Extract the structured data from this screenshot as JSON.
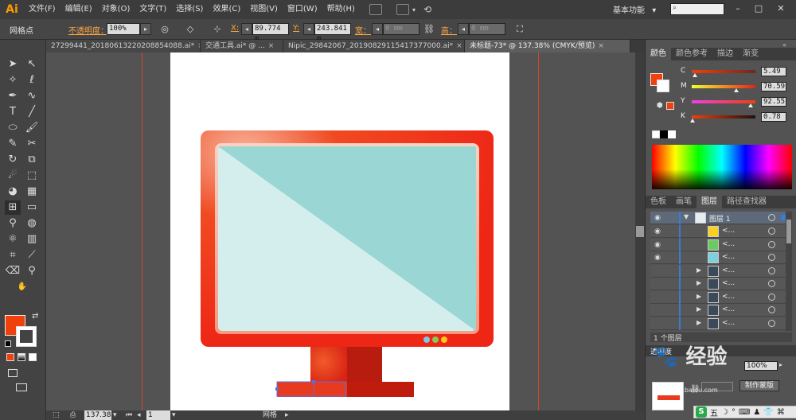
{
  "menubar": {
    "logo": "Ai",
    "items": [
      "文件(F)",
      "编辑(E)",
      "对象(O)",
      "文字(T)",
      "选择(S)",
      "效果(C)",
      "视图(V)",
      "窗口(W)",
      "帮助(H)"
    ],
    "workspace": "基本功能",
    "workspace_arrow": "▾",
    "search_placeholder": ""
  },
  "controlbar": {
    "tool_name": "网格点",
    "opacity_label": "不透明度：",
    "opacity_value": "100%",
    "x_label": "X:",
    "x_value": "89.774 m",
    "y_label": "Y:",
    "y_value": "243.841 m",
    "w_label": "宽：",
    "w_value": "0 mm",
    "h_label": "高：",
    "h_value": "0 mm"
  },
  "tabs": [
    {
      "label": "27299441_20180613220208854088.ai*",
      "active": false
    },
    {
      "label": "交通工具.ai* @ ...",
      "active": false
    },
    {
      "label": "Nipic_29842067_20190829115417377000.ai*",
      "active": false
    },
    {
      "label": "未标题-73* @ 137.38% (CMYK/预览)",
      "active": true
    }
  ],
  "tab_close": "×",
  "colors": {
    "fill": "#f0400c",
    "monitor_frame": "#f02a1a",
    "screen_light": "#d4eeee",
    "screen_dark": "#9ad6d4",
    "stand": "#c81e10",
    "dot_blue": "#7ec8e8",
    "dot_green": "#86c85a",
    "dot_yellow": "#f8c820"
  },
  "color_panel": {
    "tabs": [
      "颜色",
      "颜色参考",
      "描边",
      "渐变"
    ],
    "channels": [
      {
        "label": "C",
        "value": "5.49",
        "pct": 0.055
      },
      {
        "label": "M",
        "value": "70.59",
        "pct": 0.706
      },
      {
        "label": "Y",
        "value": "92.55",
        "pct": 0.926
      },
      {
        "label": "K",
        "value": "0.78",
        "pct": 0.008
      }
    ]
  },
  "layers_panel": {
    "tabs": [
      "色板",
      "画笔",
      "图层",
      "路径查找器"
    ],
    "layer_name": "图层 1",
    "sublayer_label": "<...",
    "sublayers": [
      {
        "thumb": "#f8d020",
        "visible": true
      },
      {
        "thumb": "#6cc860",
        "visible": true
      },
      {
        "thumb": "#7ed0dc",
        "visible": true
      },
      {
        "thumb": "#3a4a5a",
        "visible": false
      },
      {
        "thumb": "#3a4a5a",
        "visible": false
      },
      {
        "thumb": "#3a4a5a",
        "visible": false
      },
      {
        "thumb": "#3a4a5a",
        "visible": false
      },
      {
        "thumb": "#3a4a5a",
        "visible": false
      }
    ],
    "footer_count": "1 个图层",
    "eye_glyph": "◉"
  },
  "bottom_panel": {
    "tab_label": "透明度",
    "opacity_value": "100%",
    "make_mask_button": "制作蒙版"
  },
  "statusbar": {
    "zoom": "137.38",
    "page": "1",
    "tool_status": "网格"
  },
  "watermark": {
    "text": "经验",
    "site": "jingyan.baidu.com"
  },
  "ime_bar": {
    "items": [
      "S",
      "五",
      "☽",
      "°",
      "⌨",
      "♟",
      "👕",
      "⌘"
    ]
  }
}
